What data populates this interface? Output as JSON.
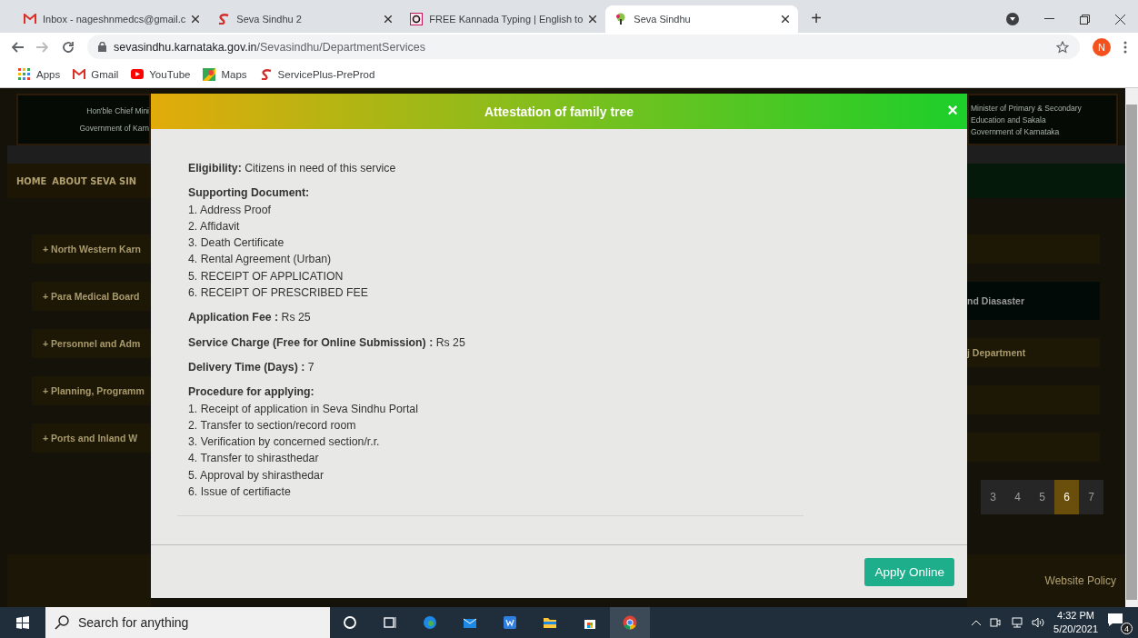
{
  "browser": {
    "tabs": [
      {
        "title": "Inbox - nageshnmedcs@gmail.c",
        "selected": false
      },
      {
        "title": "Seva Sindhu 2",
        "selected": false
      },
      {
        "title": "FREE Kannada Typing | English to",
        "selected": false
      },
      {
        "title": "Seva Sindhu",
        "selected": true
      }
    ],
    "new_tab": "+",
    "address": {
      "host": "sevasindhu.karnataka.gov.in",
      "path": "/Sevasindhu/DepartmentServices"
    },
    "profile": "N",
    "bookmarks": [
      {
        "label": "Apps"
      },
      {
        "label": "Gmail"
      },
      {
        "label": "YouTube"
      },
      {
        "label": "Maps"
      },
      {
        "label": "ServicePlus-PreProd"
      }
    ]
  },
  "background_page": {
    "left": {
      "banner": [
        "Hon'ble Chief Mini",
        "Government of Karn"
      ],
      "nav": [
        "HOME",
        "ABOUT SEVA SIN"
      ],
      "departments": [
        "+ North Western Karn",
        "+ Para Medical Board",
        "+ Personnel and Adm",
        "+ Planning, Programm",
        "+ Ports and Inland W"
      ]
    },
    "right": {
      "banner": [
        "Minister of Primary & Secondary",
        "Education and Sakala",
        "Government of Karnataka"
      ],
      "departments": [
        {
          "kind": "plain"
        },
        {
          "kind": "dark",
          "label": "nd Diasaster"
        },
        {
          "kind": "plain",
          "label": "j Department"
        },
        {
          "kind": "plain"
        },
        {
          "kind": "plain"
        }
      ],
      "pages": [
        {
          "label": "3",
          "selected": false
        },
        {
          "label": "4",
          "selected": false
        },
        {
          "label": "5",
          "selected": false
        },
        {
          "label": "6",
          "selected": true
        },
        {
          "label": "7",
          "selected": false
        }
      ],
      "footer_link": "Website Policy"
    }
  },
  "modal": {
    "title": "Attestation of family tree",
    "close": "×",
    "sections": [
      {
        "kind": "field",
        "label": "Eligibility:",
        "value": "Citizens in need of this service"
      },
      {
        "kind": "list",
        "heading": "Supporting Document:",
        "items": [
          {
            "number": "1.",
            "text": "Address Proof"
          },
          {
            "number": "2.",
            "text": "Affidavit"
          },
          {
            "number": "3.",
            "text": "Death Certificate"
          },
          {
            "number": "4.",
            "text": "Rental Agreement (Urban)"
          },
          {
            "number": "5.",
            "text": "RECEIPT OF APPLICATION"
          },
          {
            "number": "6.",
            "text": "RECEIPT OF PRESCRIBED FEE"
          }
        ]
      },
      {
        "kind": "field",
        "label": "Application Fee :",
        "value": "Rs 25"
      },
      {
        "kind": "field",
        "label": "Service Charge (Free for Online Submission) :",
        "value": "Rs 25"
      },
      {
        "kind": "field",
        "label": "Delivery Time (Days) :",
        "value": "7"
      },
      {
        "kind": "list",
        "heading": "Procedure for applying:",
        "items": [
          {
            "number": "1.",
            "text": "Receipt of application in Seva Sindhu Portal"
          },
          {
            "number": "2.",
            "text": "Transfer to section/record room"
          },
          {
            "number": "3.",
            "text": "Verification by concerned section/r.r."
          },
          {
            "number": "4.",
            "text": "Transfer to shirasthedar"
          },
          {
            "number": "5.",
            "text": "Approval by shirasthedar"
          },
          {
            "number": "6.",
            "text": "Issue of certifiacte"
          }
        ]
      }
    ],
    "button": "Apply Online"
  },
  "taskbar": {
    "search": {
      "placeholder": "Search for anything"
    },
    "time": "4:32 PM",
    "date": "5/20/2021",
    "notifications": "4"
  }
}
